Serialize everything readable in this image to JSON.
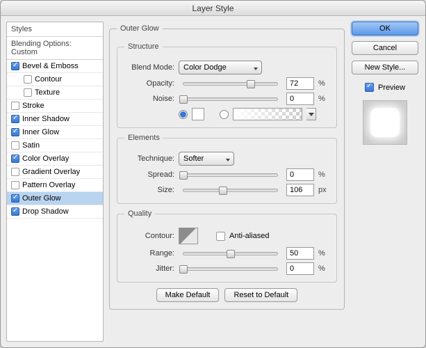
{
  "title": "Layer Style",
  "sidebar": {
    "header1": "Styles",
    "header2": "Blending Options: Custom",
    "items": [
      {
        "label": "Bevel & Emboss",
        "checked": true,
        "indent": false
      },
      {
        "label": "Contour",
        "checked": false,
        "indent": true
      },
      {
        "label": "Texture",
        "checked": false,
        "indent": true
      },
      {
        "label": "Stroke",
        "checked": false,
        "indent": false
      },
      {
        "label": "Inner Shadow",
        "checked": true,
        "indent": false
      },
      {
        "label": "Inner Glow",
        "checked": true,
        "indent": false
      },
      {
        "label": "Satin",
        "checked": false,
        "indent": false
      },
      {
        "label": "Color Overlay",
        "checked": true,
        "indent": false
      },
      {
        "label": "Gradient Overlay",
        "checked": false,
        "indent": false
      },
      {
        "label": "Pattern Overlay",
        "checked": false,
        "indent": false
      },
      {
        "label": "Outer Glow",
        "checked": true,
        "indent": false,
        "active": true
      },
      {
        "label": "Drop Shadow",
        "checked": true,
        "indent": false
      }
    ]
  },
  "panel": {
    "title": "Outer Glow",
    "structure": {
      "legend": "Structure",
      "blend_mode_label": "Blend Mode:",
      "blend_mode": "Color Dodge",
      "opacity_label": "Opacity:",
      "opacity": "72",
      "opacity_unit": "%",
      "noise_label": "Noise:",
      "noise": "0",
      "noise_unit": "%"
    },
    "elements": {
      "legend": "Elements",
      "technique_label": "Technique:",
      "technique": "Softer",
      "spread_label": "Spread:",
      "spread": "0",
      "spread_unit": "%",
      "size_label": "Size:",
      "size": "106",
      "size_unit": "px"
    },
    "quality": {
      "legend": "Quality",
      "contour_label": "Contour:",
      "antialias_label": "Anti-aliased",
      "range_label": "Range:",
      "range": "50",
      "range_unit": "%",
      "jitter_label": "Jitter:",
      "jitter": "0",
      "jitter_unit": "%"
    },
    "make_default": "Make Default",
    "reset_default": "Reset to Default"
  },
  "buttons": {
    "ok": "OK",
    "cancel": "Cancel",
    "new_style": "New Style...",
    "preview": "Preview"
  }
}
